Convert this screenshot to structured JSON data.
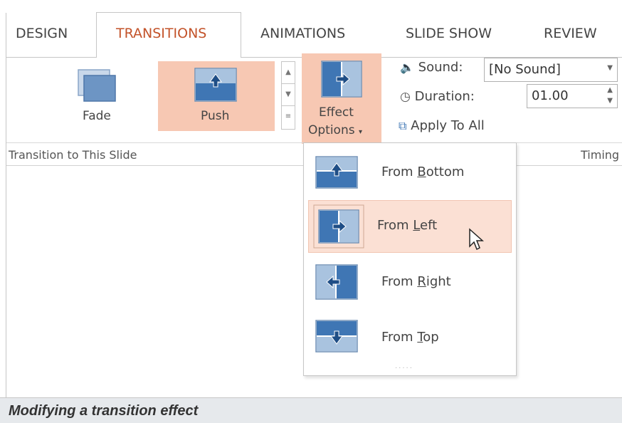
{
  "tabs": [
    {
      "label": "DESIGN"
    },
    {
      "label": "TRANSITIONS"
    },
    {
      "label": "ANIMATIONS"
    },
    {
      "label": "SLIDE SHOW"
    },
    {
      "label": "REVIEW"
    }
  ],
  "active_tab": "TRANSITIONS",
  "gallery": {
    "items": [
      {
        "label": "Fade",
        "icon": "fade-icon",
        "selected": false
      },
      {
        "label": "Push",
        "icon": "push-icon",
        "selected": true
      }
    ],
    "group_label": "Transition to This Slide"
  },
  "effect_options": {
    "label_line1": "Effect",
    "label_line2": "Options",
    "icon": "push-from-left-icon"
  },
  "timing": {
    "sound_label": "Sound:",
    "sound_value": "[No Sound]",
    "duration_label": "Duration:",
    "duration_value": "01.00",
    "apply_all_label": "Apply To All",
    "group_label": "Timing"
  },
  "dropdown": {
    "items": [
      {
        "label_pre": "From ",
        "label_u": "B",
        "label_post": "ottom",
        "icon": "push-from-bottom-icon"
      },
      {
        "label_pre": "From ",
        "label_u": "L",
        "label_post": "eft",
        "icon": "push-from-left-icon",
        "hover": true
      },
      {
        "label_pre": "From ",
        "label_u": "R",
        "label_post": "ight",
        "icon": "push-from-right-icon"
      },
      {
        "label_pre": "From ",
        "label_u": "T",
        "label_post": "op",
        "icon": "push-from-top-icon"
      }
    ],
    "more": "....."
  },
  "caption": "Modifying a transition effect",
  "colors": {
    "accent": "#c3532a",
    "selected_fill": "#f7c8b3",
    "hover_fill": "#fbe0d4",
    "icon_blue": "#3f76b4",
    "icon_light": "#a9c3df"
  }
}
